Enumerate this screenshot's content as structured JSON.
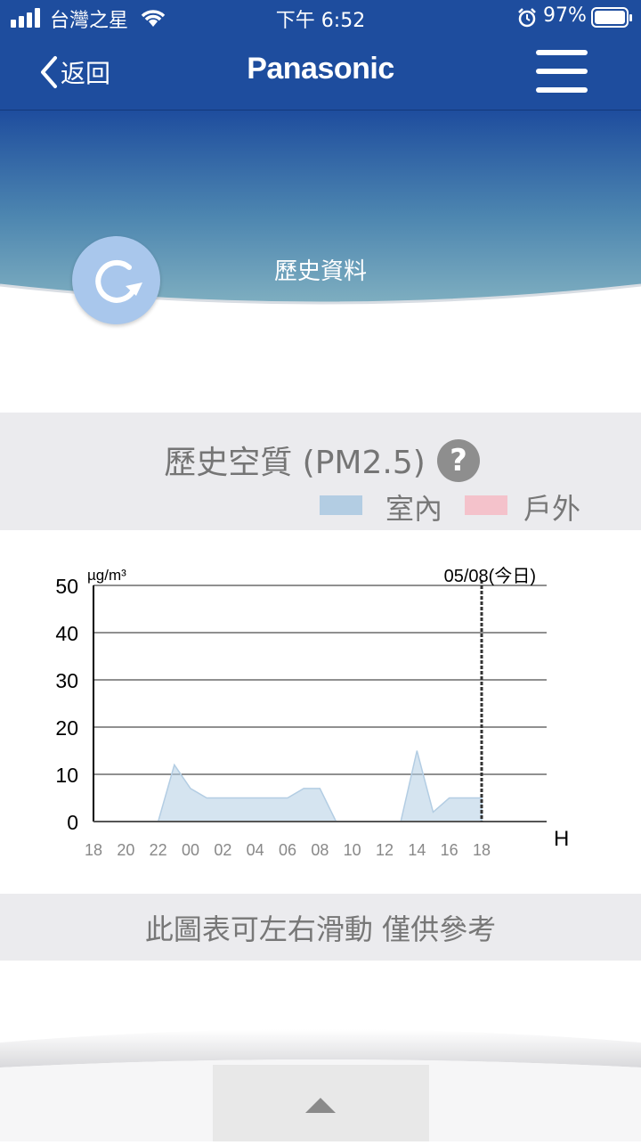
{
  "status_bar": {
    "carrier": "台灣之星",
    "time": "下午 6:52",
    "battery": "97%"
  },
  "header": {
    "back_label": "返回",
    "logo": "Panasonic"
  },
  "banner": {
    "title": "歷史資料"
  },
  "pm_section": {
    "title": "歷史空質 (PM2.5)",
    "help_icon": "?",
    "legend": [
      {
        "label": "室內",
        "color": "#b3cde3"
      },
      {
        "label": "戶外",
        "color": "#f4c2cb"
      }
    ]
  },
  "chart_data": {
    "type": "area",
    "unit_label": "µg/m³",
    "date_label": "05/08(今日)",
    "xlabel": "H",
    "ylim": [
      0,
      50
    ],
    "y_ticks": [
      "0",
      "10",
      "20",
      "30",
      "40",
      "50"
    ],
    "x_tick_labels": [
      "18",
      "20",
      "22",
      "00",
      "02",
      "04",
      "06",
      "08",
      "10",
      "12",
      "14",
      "16",
      "18"
    ],
    "series": [
      {
        "name": "室內",
        "color": "#b3cde3",
        "x": [
          0,
          1,
          2,
          3,
          4,
          5,
          6,
          7,
          8,
          9,
          10,
          11,
          12,
          13,
          14,
          15,
          16,
          17,
          18,
          19,
          20,
          21,
          22,
          23,
          24
        ],
        "values": [
          0,
          0,
          0,
          0,
          0,
          12,
          7,
          5,
          5,
          5,
          5,
          5,
          5,
          7,
          7,
          0,
          0,
          0,
          0,
          0,
          15,
          2,
          5,
          5,
          5
        ]
      },
      {
        "name": "戶外",
        "color": "#f4c2cb",
        "x": [
          0,
          24
        ],
        "values": [
          0,
          0
        ]
      }
    ],
    "today_marker_x": 24,
    "grid": true
  },
  "note": "此圖表可左右滑動 僅供參考"
}
